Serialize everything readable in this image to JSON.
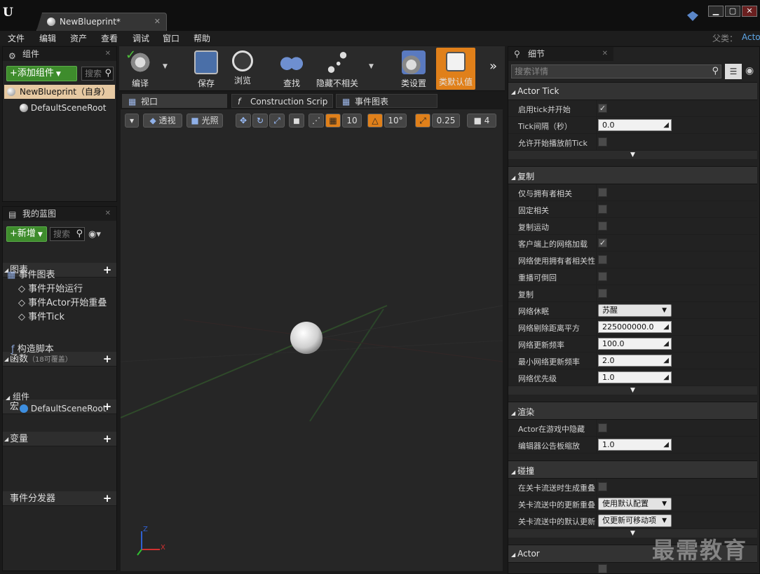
{
  "app": {
    "document_tab": "NewBlueprint*"
  },
  "menu": {
    "items": [
      "文件",
      "编辑",
      "资产",
      "查看",
      "调试",
      "窗口",
      "帮助"
    ],
    "parent_label": "父类：",
    "parent_value": "Acto"
  },
  "components": {
    "title": "组件",
    "add_button": "+添加组件",
    "search_placeholder": "搜索",
    "root_item": "NewBlueprint（自身）",
    "child_item": "DefaultSceneRoot"
  },
  "my_blueprint": {
    "title": "我的蓝图",
    "new_button": "+新增",
    "search_placeholder": "搜索",
    "sections": {
      "graphs": "图表",
      "event_graph": "事件图表",
      "events": [
        "事件开始运行",
        "事件Actor开始重叠",
        "事件Tick"
      ],
      "functions": "函数",
      "functions_note": "（18可覆盖）",
      "construction": "构造脚本",
      "macros": "宏",
      "variables": "变量",
      "components_group": "组件",
      "component_item": "DefaultSceneRoot",
      "dispatchers": "事件分发器"
    }
  },
  "toolbar": {
    "compile": "编译",
    "save": "保存",
    "browse": "浏览",
    "find": "查找",
    "hide_unrelated": "隐藏不相关",
    "class_settings": "类设置",
    "class_defaults": "类默认值"
  },
  "editor_tabs": [
    "视口",
    "Construction Scrip",
    "事件图表"
  ],
  "viewport": {
    "perspective": "透视",
    "lit": "光照",
    "grid_size": "10",
    "rotation_snap": "10°",
    "scale_snap": "0.25",
    "camera_speed": "4",
    "axis_x": "X",
    "axis_z": "Z"
  },
  "details": {
    "title": "细节",
    "search_placeholder": "搜索详情",
    "actor_tick": {
      "title": "Actor Tick",
      "rows": [
        {
          "name": "启用tick并开始",
          "checked": true
        },
        {
          "name": "Tick间隔（秒）",
          "value": "0.0"
        },
        {
          "name": "允许开始播放前Tick",
          "checked": false
        }
      ]
    },
    "replication": {
      "title": "复制",
      "rows": [
        {
          "name": "仅与拥有者相关",
          "checked": false
        },
        {
          "name": "固定相关",
          "checked": false
        },
        {
          "name": "复制运动",
          "checked": false
        },
        {
          "name": "客户端上的网络加载",
          "checked": true
        },
        {
          "name": "网络使用拥有者相关性",
          "checked": false
        },
        {
          "name": "重播可倒回",
          "checked": false
        },
        {
          "name": "复制",
          "checked": false
        },
        {
          "name": "网络休眠",
          "dropdown": "苏醒"
        },
        {
          "name": "网络剔除距离平方",
          "value": "225000000.0"
        },
        {
          "name": "网络更新频率",
          "value": "100.0"
        },
        {
          "name": "最小网络更新频率",
          "value": "2.0"
        },
        {
          "name": "网络优先级",
          "value": "1.0"
        }
      ]
    },
    "rendering": {
      "title": "渲染",
      "rows": [
        {
          "name": "Actor在游戏中隐藏",
          "checked": false
        },
        {
          "name": "编辑器公告板缩放",
          "value": "1.0"
        }
      ]
    },
    "collision": {
      "title": "碰撞",
      "rows": [
        {
          "name": "在关卡流送时生成重叠",
          "checked": false
        },
        {
          "name": "关卡流送中的更新重叠",
          "dropdown": "使用默认配置"
        },
        {
          "name": "关卡流送中的默认更新",
          "dropdown": "仅更新可移动项"
        }
      ]
    },
    "actor": {
      "title": "Actor"
    }
  },
  "watermark": "最需教育",
  "colors": {
    "accent_green": "#3e8c2c",
    "active_tool": "#e0801a",
    "link_blue": "#5fa8e8"
  }
}
